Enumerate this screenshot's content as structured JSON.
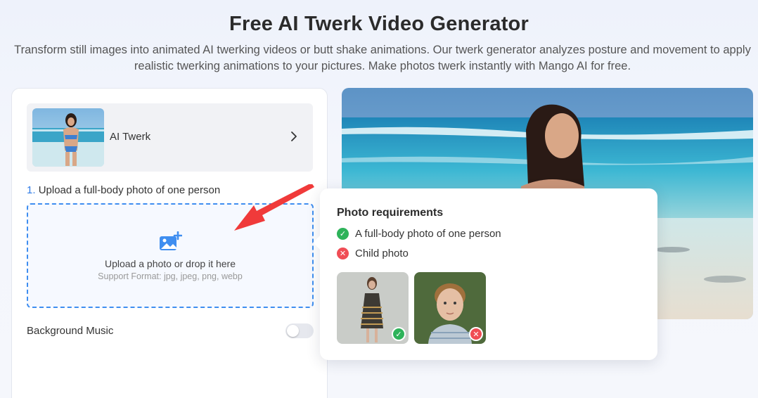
{
  "header": {
    "title": "Free AI Twerk Video Generator",
    "subtitle": "Transform still images into animated AI twerking videos or butt shake animations. Our twerk generator analyzes posture and movement to apply realistic twerking animations to your pictures. Make photos twerk instantly with Mango AI for free."
  },
  "model": {
    "label": "AI Twerk",
    "chevron_icon": "chevron-right-icon"
  },
  "upload": {
    "step_number": "1.",
    "step_label": "Upload a full-body photo of one person",
    "icon": "image-add-icon",
    "main_text": "Upload a photo or drop it here",
    "sub_text": "Support Format: jpg, jpeg, png, webp"
  },
  "music": {
    "label": "Background Music",
    "enabled": false
  },
  "requirements": {
    "title": "Photo requirements",
    "good": "A full-body photo of one person",
    "bad": "Child photo"
  },
  "colors": {
    "accent": "#2f7be6",
    "good": "#2eb35a",
    "bad": "#f04d55",
    "arrow": "#f03a3a"
  }
}
